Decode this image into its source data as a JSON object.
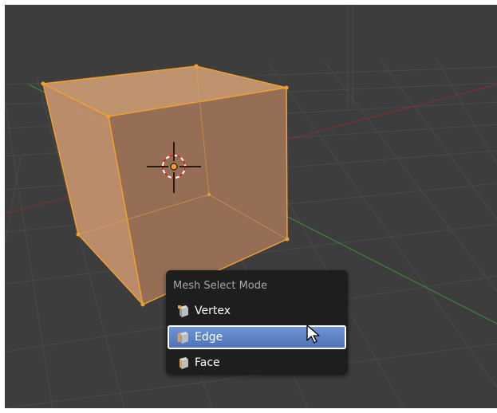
{
  "menu": {
    "title": "Mesh Select Mode",
    "items": [
      {
        "label": "Vertex",
        "icon": "vertex-select-icon",
        "selected": false
      },
      {
        "label": "Edge",
        "icon": "edge-select-icon",
        "selected": true
      },
      {
        "label": "Face",
        "icon": "face-select-icon",
        "selected": false
      }
    ]
  },
  "colors": {
    "viewport_bg": "#3d3d3d",
    "selection_orange": "#f0a030",
    "highlight_blue": "#5b83c5",
    "x_axis_red": "#8b2e2e",
    "y_axis_green": "#3e8f3e"
  }
}
